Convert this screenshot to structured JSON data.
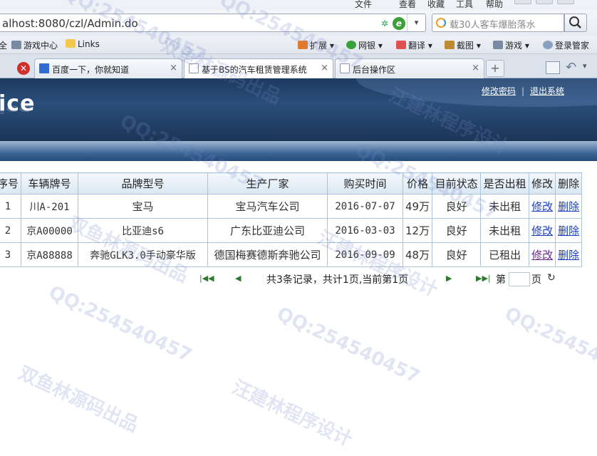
{
  "browser": {
    "menu": [
      "文件",
      "查看",
      "收藏",
      "工具",
      "帮助"
    ],
    "url": "alhost:8080/czl/Admin.do",
    "search_placeholder": "载30人客车爆胎落水",
    "favorites": [
      "全",
      "游戏中心",
      "Links"
    ],
    "tools": [
      "扩展",
      "网银",
      "翻译",
      "截图",
      "游戏",
      "登录管家"
    ],
    "tabs": [
      {
        "label": "百度一下，你就知道",
        "close": "×"
      },
      {
        "label": "基于BS的汽车租赁管理系统",
        "close": "×"
      },
      {
        "label": "后台操作区",
        "close": "×"
      }
    ],
    "new_tab": "+"
  },
  "header": {
    "brand": "ice",
    "links": {
      "change_password": "修改密码",
      "separator": "|",
      "logout": "退出系统"
    }
  },
  "table": {
    "columns": [
      "序号",
      "车辆牌号",
      "品牌型号",
      "生产厂家",
      "购买时间",
      "价格",
      "目前状态",
      "是否出租",
      "修改",
      "删除"
    ],
    "rows": [
      {
        "no": "1",
        "plate": "川A-201",
        "model": "宝马",
        "maker": "宝马汽车公司",
        "date": "2016-07-07",
        "price": "49万",
        "status": "良好",
        "rented": "未出租",
        "edit": "修改",
        "delete": "删除"
      },
      {
        "no": "2",
        "plate": "京A00000",
        "model": "比亚迪s6",
        "maker": "广东比亚迪公司",
        "date": "2016-03-03",
        "price": "12万",
        "status": "良好",
        "rented": "未出租",
        "edit": "修改",
        "delete": "删除"
      },
      {
        "no": "3",
        "plate": "京A88888",
        "model": "奔驰GLK3.0手动豪华版",
        "maker": "德国梅赛德斯奔驰公司",
        "date": "2016-09-09",
        "price": "48万",
        "status": "良好",
        "rented": "已租出",
        "edit": "修改",
        "delete": "删除"
      }
    ]
  },
  "pager": {
    "summary": "共3条记录，共计1页,当前第1页",
    "goto_prefix": "第",
    "goto_suffix": "页",
    "first_icon": "first-page-icon",
    "prev_icon": "prev-page-icon",
    "next_icon": "next-page-icon",
    "last_icon": "last-page-icon",
    "go_icon": "refresh-icon"
  },
  "watermarks": [
    "QQ:254540457",
    "双鱼林源码出品",
    "汪建林程序设计"
  ]
}
